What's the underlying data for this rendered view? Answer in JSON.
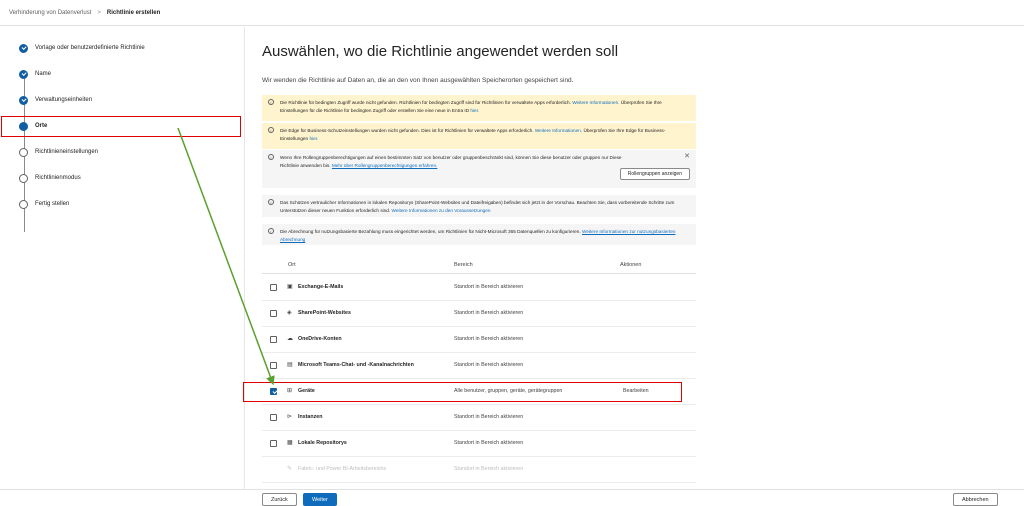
{
  "breadcrumb": {
    "parent": "Verhinderung von Datenverlust",
    "separator": ">",
    "current": "Richtlinie erstellen"
  },
  "steps": [
    {
      "label": "Vorlage oder benutzerdefinierte Richtlinie",
      "state": "done"
    },
    {
      "label": "Name",
      "state": "done"
    },
    {
      "label": "Verwaltungseinheiten",
      "state": "done"
    },
    {
      "label": "Orte",
      "state": "current"
    },
    {
      "label": "Richtlinieneinstellungen",
      "state": "pending"
    },
    {
      "label": "Richtlinienmodus",
      "state": "pending"
    },
    {
      "label": "Fertig stellen",
      "state": "pending"
    }
  ],
  "main": {
    "title": "Auswählen, wo die Richtlinie angewendet werden soll",
    "subtitle": "Wir wenden die Richtlinie auf Daten an, die an den von Ihnen ausgewählten Speicherorten gespeichert sind."
  },
  "messages": {
    "m1_text": "Die Richtlinie für bedingten Zugriff wurde nicht gefunden. Richtlinien für bedingten Zugriff sind für Richtlinien für verwaltete Apps erforderlich.",
    "m1_link": "Weitere Informationen.",
    "m1_text2": "Überprüfen Sie Ihre Einstellungen für die Richtlinie für bedingten Zugriff oder erstellen Sie eine neue in Entra ID",
    "m1_link2": "hier.",
    "m2_text": "Die Edge für Business-Schutzeinstellungen wurden nicht gefunden. Dies ist für Richtlinien für verwaltete Apps erforderlich.",
    "m2_link": "Weitere Informationen.",
    "m2_text2": "Überprüfen Sie Ihre Edge für Business-Einstellungen",
    "m2_link2": "hier.",
    "m3_text": "Wenn Ihre Rollengruppenberechtigungen auf einen bestimmten Satz von benutzer oder gruppenbeschränkt sind, können Sie diese benutzer oder gruppen nur Diese Richtlinie anwenden bis.",
    "m3_link": "Mehr über Rollengruppenberechtigungen erfahren.",
    "m3_button": "Rollengruppen anzeigen",
    "m3_close": "✕",
    "m4_text": "Das Schützen vertraulicher Informationen in lokalen Repositorys (SharePoint-Websites und Dateifreigaben) befindet sich jetzt in der Vorschau. Beachten Sie, dass vorbereitende Schritte zum Unterstützen dieser neuen Funktion erforderlich sind.",
    "m4_link": "Weitere Informationen zu den Voraussetzungen",
    "m5_text": "Die Abrechnung für nutzungsbasierte Bezahlung muss eingerichtet werden, um Richtlinien für Nicht-Microsoft 365 Datenquellen zu konfigurieren.",
    "m5_link": "Weitere Informationen zur nutzungsbasierten Abrechnung"
  },
  "table": {
    "headers": {
      "location": "Ort",
      "scope": "Bereich",
      "actions": "Aktionen"
    },
    "rows": [
      {
        "icon": "exchange-icon",
        "glyph": "▣",
        "location": "Exchange-E-Mails",
        "scope": "Standort in Bereich aktivieren",
        "action": "",
        "checked": false
      },
      {
        "icon": "sharepoint-icon",
        "glyph": "◈",
        "location": "SharePoint-Websites",
        "scope": "Standort in Bereich aktivieren",
        "action": "",
        "checked": false
      },
      {
        "icon": "onedrive-icon",
        "glyph": "☁",
        "location": "OneDrive-Konten",
        "scope": "Standort in Bereich aktivieren",
        "action": "",
        "checked": false
      },
      {
        "icon": "teams-icon",
        "glyph": "▤",
        "location": "Microsoft Teams-Chat- und -Kanalnachrichten",
        "scope": "Standort in Bereich aktivieren",
        "action": "",
        "checked": false
      },
      {
        "icon": "windows-icon",
        "glyph": "⊞",
        "location": "Geräte",
        "scope": "Alle benutzer, gruppen, geräte, gerätegruppen",
        "action": "Bearbeiten",
        "checked": true
      },
      {
        "icon": "instances-icon",
        "glyph": "⊳",
        "location": "Instanzen",
        "scope": "Standort in Bereich aktivieren",
        "action": "",
        "checked": false
      },
      {
        "icon": "repository-icon",
        "glyph": "▦",
        "location": "Lokale Repositorys",
        "scope": "Standort in Bereich aktivieren",
        "action": "",
        "checked": false
      },
      {
        "icon": "fabric-icon",
        "glyph": "✎",
        "location": "Fabric- und Power BI-Arbeitsbereiche",
        "scope": "Standort in Bereich aktivieren",
        "action": "",
        "checked": false
      }
    ]
  },
  "footer": {
    "back": "Zurück",
    "next": "Weiter",
    "cancel": "Abbrechen"
  },
  "colors": {
    "accent": "#0f6cbd",
    "highlight": "#e00000",
    "arrow": "#5aa02c",
    "warn_bg": "#fff4ce",
    "info_bg": "#f5f5f5"
  }
}
